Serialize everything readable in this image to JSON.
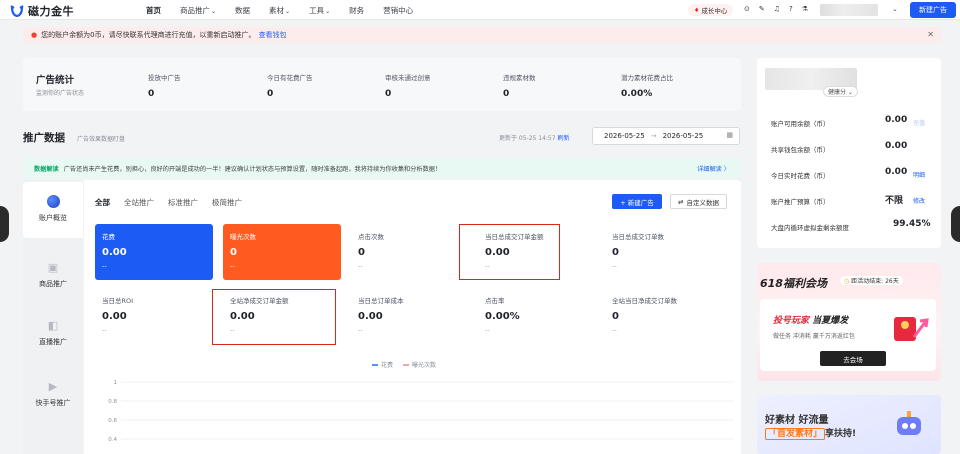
{
  "app": {
    "name": "磁力金牛"
  },
  "nav": {
    "items": [
      {
        "label": "首页",
        "active": true,
        "caret": false
      },
      {
        "label": "商品推广",
        "active": false,
        "caret": true
      },
      {
        "label": "数据",
        "active": false,
        "caret": false
      },
      {
        "label": "素材",
        "active": false,
        "caret": true
      },
      {
        "label": "工具",
        "active": false,
        "caret": true
      },
      {
        "label": "财务",
        "active": false,
        "caret": false
      },
      {
        "label": "营销中心",
        "active": false,
        "caret": false
      }
    ],
    "growth_center": "成长中心",
    "new_ad": "新建广告"
  },
  "alert": {
    "text": "您的账户余额为0币，请尽快联系代理商进行充值，以重新启动推广。",
    "link": "查看钱包"
  },
  "ad_stats": {
    "title": "广告统计",
    "subtitle": "监测你的广告状态",
    "items": [
      {
        "label": "投放中广告",
        "value": "0"
      },
      {
        "label": "今日有花费广告",
        "value": "0"
      },
      {
        "label": "审核未通过创意",
        "value": "0"
      },
      {
        "label": "违规素材数",
        "value": "0"
      },
      {
        "label": "潜力素材花费占比",
        "value": "0.00%"
      }
    ]
  },
  "promo_data": {
    "title": "推广数据",
    "subtitle": "广告效果数据盯盘",
    "updated": "更新于 05-25 14:57",
    "refresh": "刷新",
    "date_start": "2026-05-25",
    "date_end": "2026-05-25"
  },
  "tip": {
    "tag": "数据解读",
    "text": "广告还尚未产生花费，别担心，良好的开端是成功的一半！建议确认计划状态与预算设置，随时准备起跑，我将持续为你收集和分析数据！",
    "link": "详细解读 〉"
  },
  "side_tabs": [
    "账户概览",
    "商品推广",
    "直播推广",
    "快手号推广"
  ],
  "tabs": [
    "全部",
    "全站推广",
    "标准推广",
    "极简推广"
  ],
  "panel": {
    "new_ad": "+ 新建广告",
    "custom": "自定义数据"
  },
  "metrics": [
    {
      "label": "花费",
      "value": "0.00",
      "delta": "--"
    },
    {
      "label": "曝光次数",
      "value": "0",
      "delta": "--"
    },
    {
      "label": "点击次数",
      "value": "0",
      "delta": "--"
    },
    {
      "label": "当日总成交订单金额",
      "value": "0.00",
      "delta": "--"
    },
    {
      "label": "当日总成交订单数",
      "value": "0",
      "delta": "--"
    },
    {
      "label": "当日总ROI",
      "value": "0.00",
      "delta": "--"
    },
    {
      "label": "全站净成交订单金额",
      "value": "0.00",
      "delta": "--"
    },
    {
      "label": "当日总订单成本",
      "value": "0.00",
      "delta": "--"
    },
    {
      "label": "点击率",
      "value": "0.00%",
      "delta": "--"
    },
    {
      "label": "全站当日净成交订单数",
      "value": "0",
      "delta": "--"
    }
  ],
  "chart_data": {
    "type": "line",
    "series": [
      {
        "name": "花费",
        "color": "#5b8ff9"
      },
      {
        "name": "曝光次数",
        "color": "#f6a2b8"
      }
    ],
    "y_ticks": [
      "1",
      "0.8",
      "0.6",
      "0.4",
      "0.2"
    ],
    "ylim": [
      0,
      1
    ],
    "grid": true
  },
  "account": {
    "badge": "健康分 ⌄",
    "rows": [
      {
        "label": "账户可用余额（币）",
        "value": "0.00",
        "action": "充值",
        "disabled": true
      },
      {
        "label": "共享钱包余额（币）",
        "value": "0.00",
        "action": "",
        "disabled": false
      },
      {
        "label": "今日实时花费（币）",
        "value": "0.00",
        "action": "明细",
        "disabled": false
      },
      {
        "label": "账户推广预算（币）",
        "value": "不限",
        "action": "修改",
        "disabled": false
      },
      {
        "label": "大盘内循环虚拟金剩余额度",
        "value": "99.45%",
        "action": "",
        "disabled": false
      }
    ]
  },
  "promo_card": {
    "title": "618福利会场",
    "badge": "距活动结束: 26天",
    "headline_a": "投号玩家",
    "headline_b": " 当夏爆发",
    "sub": "做任务 冲消耗 赢千万消返红包",
    "cta": "去会场"
  },
  "promo_card2": {
    "line1": "好素材 好流量",
    "highlight": "「首发素材」",
    "line2_rest": "享扶持!"
  }
}
